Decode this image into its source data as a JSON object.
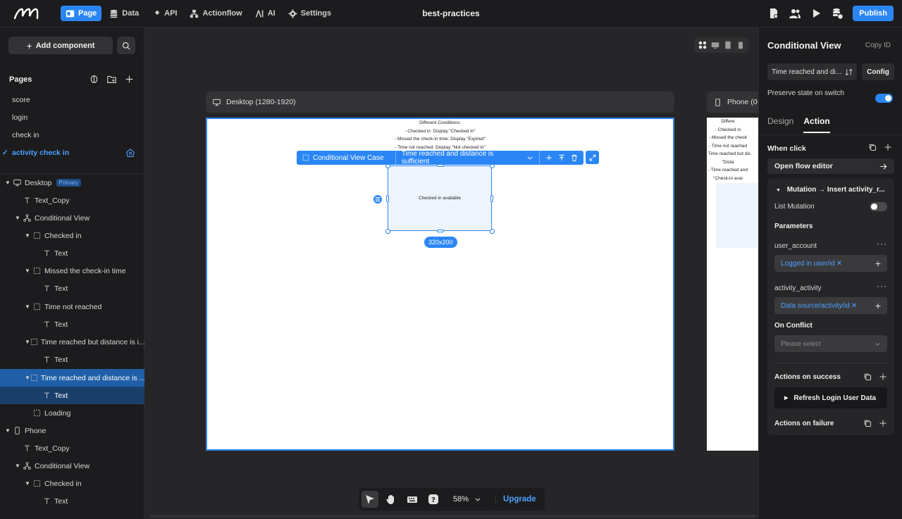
{
  "nav": {
    "items": [
      {
        "label": "Page",
        "icon": "page-icon",
        "active": true
      },
      {
        "label": "Data",
        "icon": "database-icon"
      },
      {
        "label": "API",
        "icon": "api-icon"
      },
      {
        "label": "Actionflow",
        "icon": "actionflow-icon"
      },
      {
        "label": "AI",
        "icon": "ai-icon"
      },
      {
        "label": "Settings",
        "icon": "gear-icon"
      }
    ],
    "title": "best-practices",
    "publish_label": "Publish"
  },
  "left": {
    "add_component": "Add component",
    "pages_header": "Pages",
    "pages": [
      "score",
      "login",
      "check in",
      "activity check in"
    ],
    "tree": [
      {
        "label": "Desktop",
        "badge": "Primary"
      },
      {
        "label": "Text_Copy"
      },
      {
        "label": "Conditional View"
      },
      {
        "label": "Checked in"
      },
      {
        "label": "Text"
      },
      {
        "label": "Missed the check-in time"
      },
      {
        "label": "Text"
      },
      {
        "label": "Time not reached"
      },
      {
        "label": "Text"
      },
      {
        "label": "Time reached but distance is i..."
      },
      {
        "label": "Text"
      },
      {
        "label": "Time reached and distance is ..."
      },
      {
        "label": "Text"
      },
      {
        "label": "Loading"
      },
      {
        "label": "Phone"
      },
      {
        "label": "Text_Copy"
      },
      {
        "label": "Conditional View"
      },
      {
        "label": "Checked in"
      },
      {
        "label": "Text"
      }
    ]
  },
  "canvas": {
    "desktop_label": "Desktop (1280-1920)",
    "phone_label": "Phone (0-",
    "frame_text": [
      "Different Conditions:",
      "- Checked in: Display \"Checked in\"",
      "- Missed the check-in time: Display \"Expired\"",
      "- Time not reached: Display \"Not checked in\""
    ],
    "phone_text": [
      "Differe",
      "- Checked in",
      "- Missed the check",
      "- Time not reached",
      "- Time reached but dis",
      "\"Dista",
      "- Time reached and",
      "\"Check-in avai"
    ],
    "toolbar_case_label": "Conditional View Case",
    "toolbar_case_value": "Time reached and distance is sufficient",
    "selected_text": "Checked in available",
    "size_label": "320x200",
    "zoom": "58%",
    "upgrade_label": "Upgrade"
  },
  "right": {
    "title": "Conditional View",
    "copy_id": "Copy ID",
    "case_value": "Time reached and di...",
    "config_label": "Config",
    "preserve_label": "Preserve state on switch",
    "preserve_on": true,
    "tabs": [
      "Design",
      "Action"
    ],
    "active_tab": "Action",
    "when_click": "When click",
    "open_flow": "Open flow editor",
    "mutation_title": "Mutation → Insert activity_r...",
    "list_mutation": "List Mutation",
    "parameters": "Parameters",
    "param1_name": "user_account",
    "param1_value": "Logged in user/id",
    "param2_name": "activity_activity",
    "param2_value": "Data source/activity/id",
    "on_conflict": "On Conflict",
    "conflict_placeholder": "Please select",
    "actions_success": "Actions on success",
    "refresh_action": "Refresh Login User Data",
    "actions_failure": "Actions on failure"
  },
  "colors": {
    "accent": "#2b86f5",
    "background": "#1c1c1e",
    "link": "#4ea1ff"
  }
}
